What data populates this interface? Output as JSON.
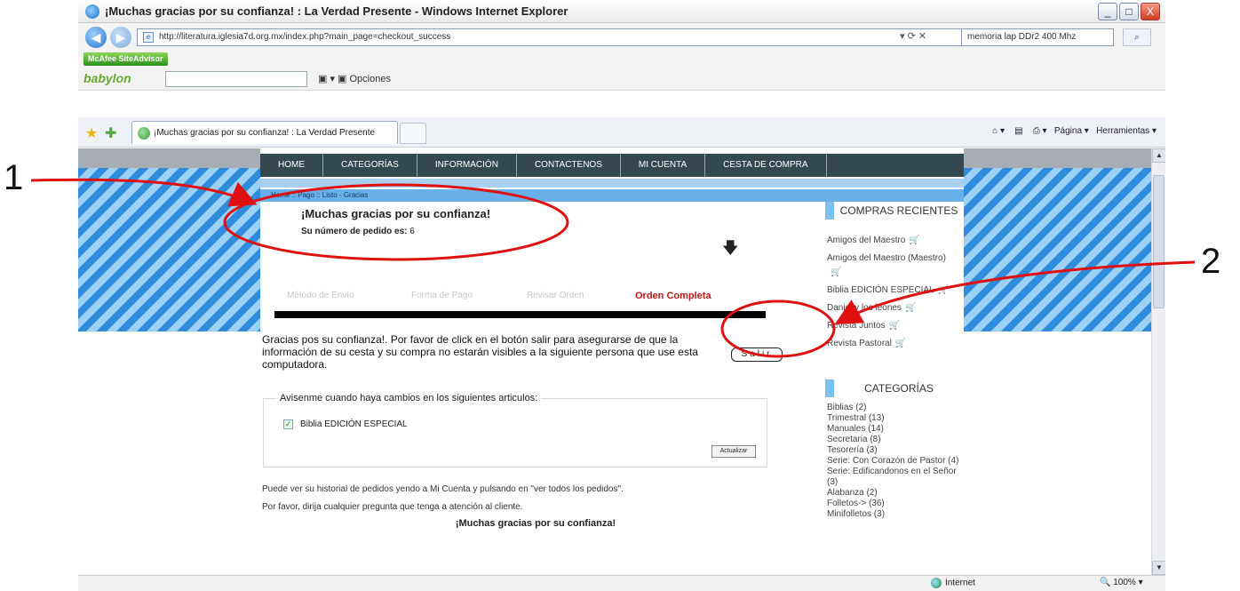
{
  "window": {
    "title": "¡Muchas gracias por su confianza! : La Verdad Presente - Windows Internet Explorer",
    "controls": [
      "_",
      "□",
      "X"
    ]
  },
  "address_bar": {
    "url": "http://literatura.iglesia7d.org.mx/index.php?main_page=checkout_success",
    "search_value": "memoria lap DDr2 400 Mhz"
  },
  "toolbars": {
    "mcafee_label": "McAfee SiteAdvisor",
    "babylon_label": "babylon",
    "opciones_label": "Opciones"
  },
  "tab": {
    "label": "¡Muchas gracias por su confianza! : La Verdad Presente"
  },
  "command_bar": {
    "pagina": "Página",
    "herramientas": "Herramientas"
  },
  "site": {
    "nav": [
      "HOME",
      "CATEGORÍAS",
      "INFORMACIÓN",
      "CONTACTENOS",
      "MI CUENTA",
      "CESTA DE COMPRA"
    ],
    "breadcrumb": "Home :: Pago :: Listo - Gracias"
  },
  "main": {
    "heading": "¡Muchas gracias por su confianza!",
    "order_label": "Su número de pedido es:",
    "order_number": "6",
    "steps": [
      "Método de Envío",
      "Forma de Pago",
      "Revisar Orden",
      "Orden Completa"
    ],
    "thanks_text": "Gracias pos su confianza!. Por favor de click en el botón salir para asegurarse de que la información de su cesta y su compra no estarán visibles a la siguiente persona que use esta computadora.",
    "salir_label": "Salir",
    "notify_legend": "Avisenme cuando haya cambios en los siguientes articulos:",
    "notify_item": "Biblia EDICIÓN ESPECIAL",
    "actualizar_label": "Actualizar",
    "history_text": "Puede ver su historial de pedidos yendo a Mi Cuenta y pulsando en \"ver todos los pedidos\".",
    "contact_text": "Por favor, dirija cualquier pregunta que tenga a atención al cliente.",
    "footer_thanks": "¡Muchas gracias por su confianza!"
  },
  "sidebar": {
    "recent_heading": "COMPRAS RECIENTES",
    "recent_items": [
      "Amigos del Maestro",
      "Amigos del Maestro (Maestro)",
      "Biblia EDICIÓN ESPECIAL",
      "Daniel y los leones",
      "Revista Juntos",
      "Revista Pastoral"
    ],
    "cats_heading": "CATEGORÍAS",
    "categories": [
      "Biblias (2)",
      "Trimestral (13)",
      "Manuales (14)",
      "Secretaria (8)",
      "Tesorería (3)",
      "Serie: Con Corazón de Pastor (4)",
      "Serie: Edificandonos en el Señor (3)",
      "Alabanza (2)",
      "Folletos-> (36)",
      "Minifolletos (3)"
    ]
  },
  "status_bar": {
    "zone": "Internet",
    "zoom": "100%"
  },
  "annotations": {
    "label_1": "1",
    "label_2": "2",
    "color": "#e01010"
  }
}
